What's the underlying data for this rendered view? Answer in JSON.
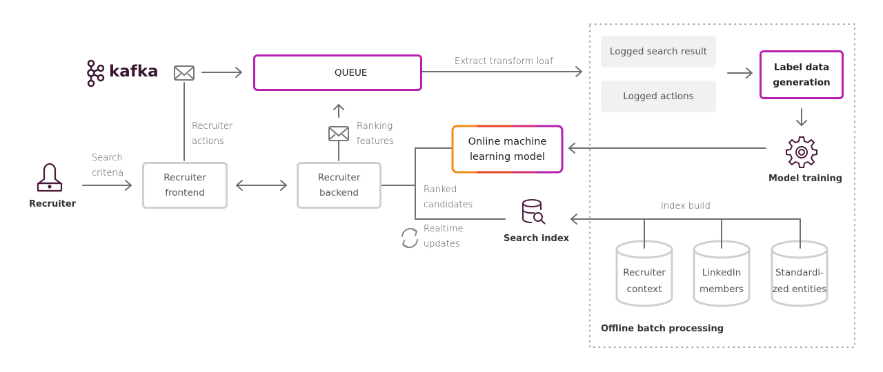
{
  "colors": {
    "accent_purple": "#b620b0",
    "icon_dark": "#4a1a3c",
    "line_grey": "#6e6e6e",
    "box_grey": "#cfcfcf",
    "log_bg": "#f1f1f1",
    "gradient": [
      "#f08c1e",
      "#e5462a",
      "#d42e74",
      "#b620b0"
    ]
  },
  "kafka": {
    "logo_text": "kafka",
    "icon": "kafka-logo-icon"
  },
  "recruiter": {
    "label": "Recruiter",
    "icon": "recruiter-laptop-icon"
  },
  "edges": {
    "search_criteria": [
      "Search",
      "criteria"
    ],
    "recruiter_actions": [
      "Recruiter",
      "actions"
    ],
    "ranking_features": [
      "Ranking",
      "features"
    ],
    "extract": "Extract transform loaf",
    "ranked_candidates": [
      "Ranked",
      "candidates"
    ],
    "realtime_updates": [
      "Realtime",
      "updates"
    ],
    "index_build": "Index build"
  },
  "nodes": {
    "queue": {
      "label": "QUEUE",
      "icon": "documents-icon"
    },
    "frontend": [
      "Recruiter",
      "frontend"
    ],
    "backend": [
      "Recruiter",
      "backend"
    ],
    "ml_model": [
      "Online machine",
      "learning model"
    ],
    "search_index": {
      "label": "Search index",
      "icon": "database-search-icon"
    },
    "logged_search": "Logged search result",
    "logged_actions": "Logged actions",
    "label_gen": [
      "Label data",
      "generation"
    ],
    "model_training": {
      "label": "Model training",
      "icon": "gear-icon"
    }
  },
  "databases": [
    {
      "lines": [
        "Recruiter",
        "context"
      ]
    },
    {
      "lines": [
        "LinkedIn",
        "members"
      ]
    },
    {
      "lines": [
        "Standardi-",
        "zed entities"
      ]
    }
  ],
  "offline_group": {
    "label": "Offline batch processing"
  }
}
